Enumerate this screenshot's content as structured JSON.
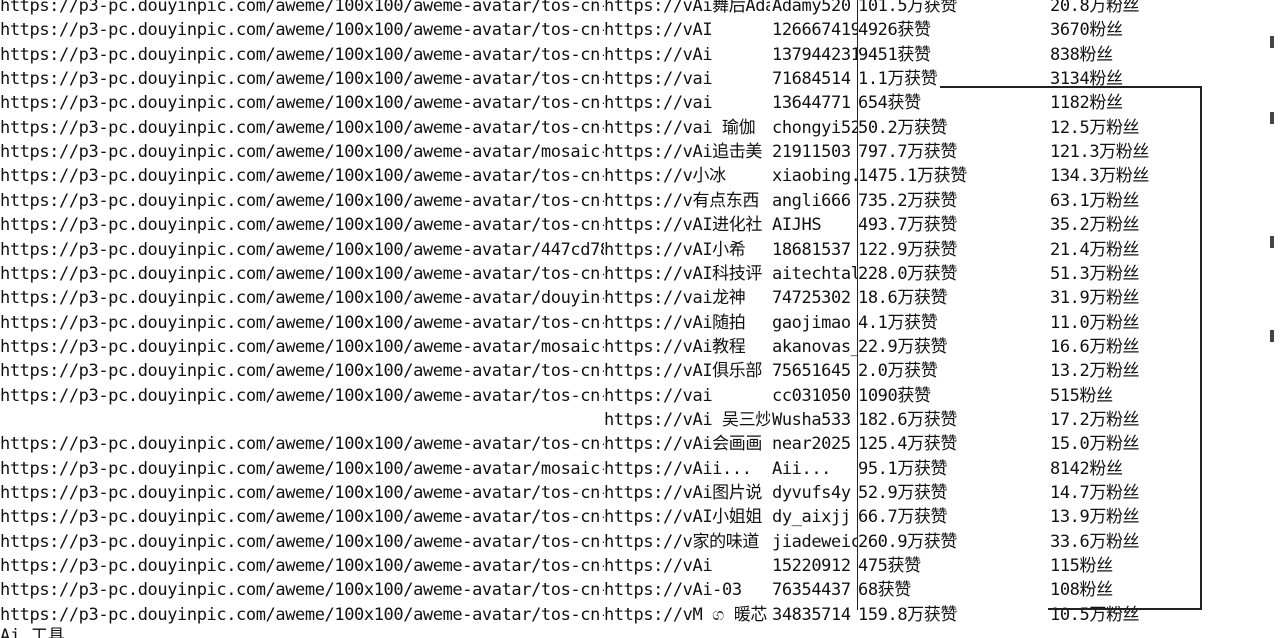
{
  "rows": [
    {
      "avatar": "https://p3-pc.douyinpic.com/aweme/100x100/aweme-avatar/tos-cn-i-0",
      "url": "https://vAi舞后Ada",
      "id": "Adamy520",
      "likes": "101.5万获赞",
      "fans": "20.8万粉丝"
    },
    {
      "avatar": "https://p3-pc.douyinpic.com/aweme/100x100/aweme-avatar/tos-cn-avt",
      "url": "https://vAI",
      "id": "126667419",
      "likes": "4926获赞",
      "fans": "3670粉丝"
    },
    {
      "avatar": "https://p3-pc.douyinpic.com/aweme/100x100/aweme-avatar/tos-cn-avt",
      "url": "https://vAi",
      "id": "137944231",
      "likes": "9451获赞",
      "fans": "838粉丝"
    },
    {
      "avatar": "https://p3-pc.douyinpic.com/aweme/100x100/aweme-avatar/tos-cn-i-0",
      "url": "https://vai",
      "id": "71684514",
      "likes": "1.1万获赞",
      "fans": "3134粉丝"
    },
    {
      "avatar": "https://p3-pc.douyinpic.com/aweme/100x100/aweme-avatar/tos-cn-avt",
      "url": "https://vai",
      "id": "13644771",
      "likes": "654获赞",
      "fans": "1182粉丝"
    },
    {
      "avatar": "https://p3-pc.douyinpic.com/aweme/100x100/aweme-avatar/tos-cn-i-0",
      "url": "https://vai 瑜伽",
      "id": "chongyi52",
      "likes": "50.2万获赞",
      "fans": "12.5万粉丝"
    },
    {
      "avatar": "https://p3-pc.douyinpic.com/aweme/100x100/aweme-avatar/mosaic-leg",
      "url": "https://vAi追击美",
      "id": "21911503",
      "likes": "797.7万获赞",
      "fans": "121.3万粉丝"
    },
    {
      "avatar": "https://p3-pc.douyinpic.com/aweme/100x100/aweme-avatar/tos-cn-avt",
      "url": "https://v小冰",
      "id": "xiaobing.",
      "likes": "1475.1万获赞",
      "fans": "134.3万粉丝"
    },
    {
      "avatar": "https://p3-pc.douyinpic.com/aweme/100x100/aweme-avatar/tos-cn-i-0",
      "url": "https://v有点东西",
      "id": "angli666",
      "likes": "735.2万获赞",
      "fans": "63.1万粉丝"
    },
    {
      "avatar": "https://p3-pc.douyinpic.com/aweme/100x100/aweme-avatar/tos-cn-avt",
      "url": "https://vAI进化社",
      "id": "AIJHS",
      "likes": "493.7万获赞",
      "fans": "35.2万粉丝"
    },
    {
      "avatar": "https://p3-pc.douyinpic.com/aweme/100x100/aweme-avatar/447cd7848",
      "url": "https://vAI小希",
      "id": "18681537",
      "likes": "122.9万获赞",
      "fans": "21.4万粉丝"
    },
    {
      "avatar": "https://p3-pc.douyinpic.com/aweme/100x100/aweme-avatar/tos-cn-i-0",
      "url": "https://vAI科技评",
      "id": "aitechtal",
      "likes": "228.0万获赞",
      "fans": "51.3万粉丝"
    },
    {
      "avatar": "https://p3-pc.douyinpic.com/aweme/100x100/aweme-avatar/douyin-use",
      "url": "https://vai龙神",
      "id": "74725302",
      "likes": "18.6万获赞",
      "fans": "31.9万粉丝"
    },
    {
      "avatar": "https://p3-pc.douyinpic.com/aweme/100x100/aweme-avatar/tos-cn-avt",
      "url": "https://vAi随拍",
      "id": "gaojimao",
      "likes": "4.1万获赞",
      "fans": "11.0万粉丝"
    },
    {
      "avatar": "https://p3-pc.douyinpic.com/aweme/100x100/aweme-avatar/mosaic-leg",
      "url": "https://vAi教程",
      "id": "akanovas_",
      "likes": "22.9万获赞",
      "fans": "16.6万粉丝"
    },
    {
      "avatar": "https://p3-pc.douyinpic.com/aweme/100x100/aweme-avatar/tos-cn-i-0",
      "url": "https://vAI俱乐部",
      "id": "75651645",
      "likes": "2.0万获赞",
      "fans": "13.2万粉丝"
    },
    {
      "avatar": "https://p3-pc.douyinpic.com/aweme/100x100/aweme-avatar/tos-cn-avt",
      "url": "https://vai",
      "id": "cc031050",
      "likes": "1090获赞",
      "fans": "515粉丝"
    },
    {
      "avatar": "",
      "url": "https://vAi 吴三炒",
      "id": "Wusha533",
      "likes": "182.6万获赞",
      "fans": "17.2万粉丝"
    },
    {
      "avatar": "https://p3-pc.douyinpic.com/aweme/100x100/aweme-avatar/tos-cn-i-0",
      "url": "https://vAi会画画",
      "id": "near2025",
      "likes": "125.4万获赞",
      "fans": "15.0万粉丝"
    },
    {
      "avatar": "https://p3-pc.douyinpic.com/aweme/100x100/aweme-avatar/mosaic-leg",
      "url": "https://vAii...",
      "id": "Aii...",
      "likes": "95.1万获赞",
      "fans": "8142粉丝"
    },
    {
      "avatar": "https://p3-pc.douyinpic.com/aweme/100x100/aweme-avatar/tos-cn-i-0",
      "url": "https://vAi图片说",
      "id": "dyvufs4y",
      "likes": "52.9万获赞",
      "fans": "14.7万粉丝"
    },
    {
      "avatar": "https://p3-pc.douyinpic.com/aweme/100x100/aweme-avatar/tos-cn-i-0",
      "url": "https://vAI小姐姐",
      "id": "dy_aixjj",
      "likes": "66.7万获赞",
      "fans": "13.9万粉丝"
    },
    {
      "avatar": "https://p3-pc.douyinpic.com/aweme/100x100/aweme-avatar/tos-cn-avt",
      "url": "https://v家的味道",
      "id": "jiadeweic",
      "likes": "260.9万获赞",
      "fans": "33.6万粉丝"
    },
    {
      "avatar": "https://p3-pc.douyinpic.com/aweme/100x100/aweme-avatar/tos-cn-i-0",
      "url": "https://vAi",
      "id": "15220912",
      "likes": "475获赞",
      "fans": "115粉丝"
    },
    {
      "avatar": "https://p3-pc.douyinpic.com/aweme/100x100/aweme-avatar/tos-cn-i-0",
      "url": "https://vAi-03",
      "id": "76354437",
      "likes": "68获赞",
      "fans": "108粉丝"
    },
    {
      "avatar": "https://p3-pc.douyinpic.com/aweme/100x100/aweme-avatar/tos-cn-i-0",
      "url": "https://vM ග 暖芯",
      "id": "34835714",
      "likes": "159.8万获赞",
      "fans": "10.5万粉丝"
    }
  ],
  "partial_footer_text": "Ai 工具"
}
